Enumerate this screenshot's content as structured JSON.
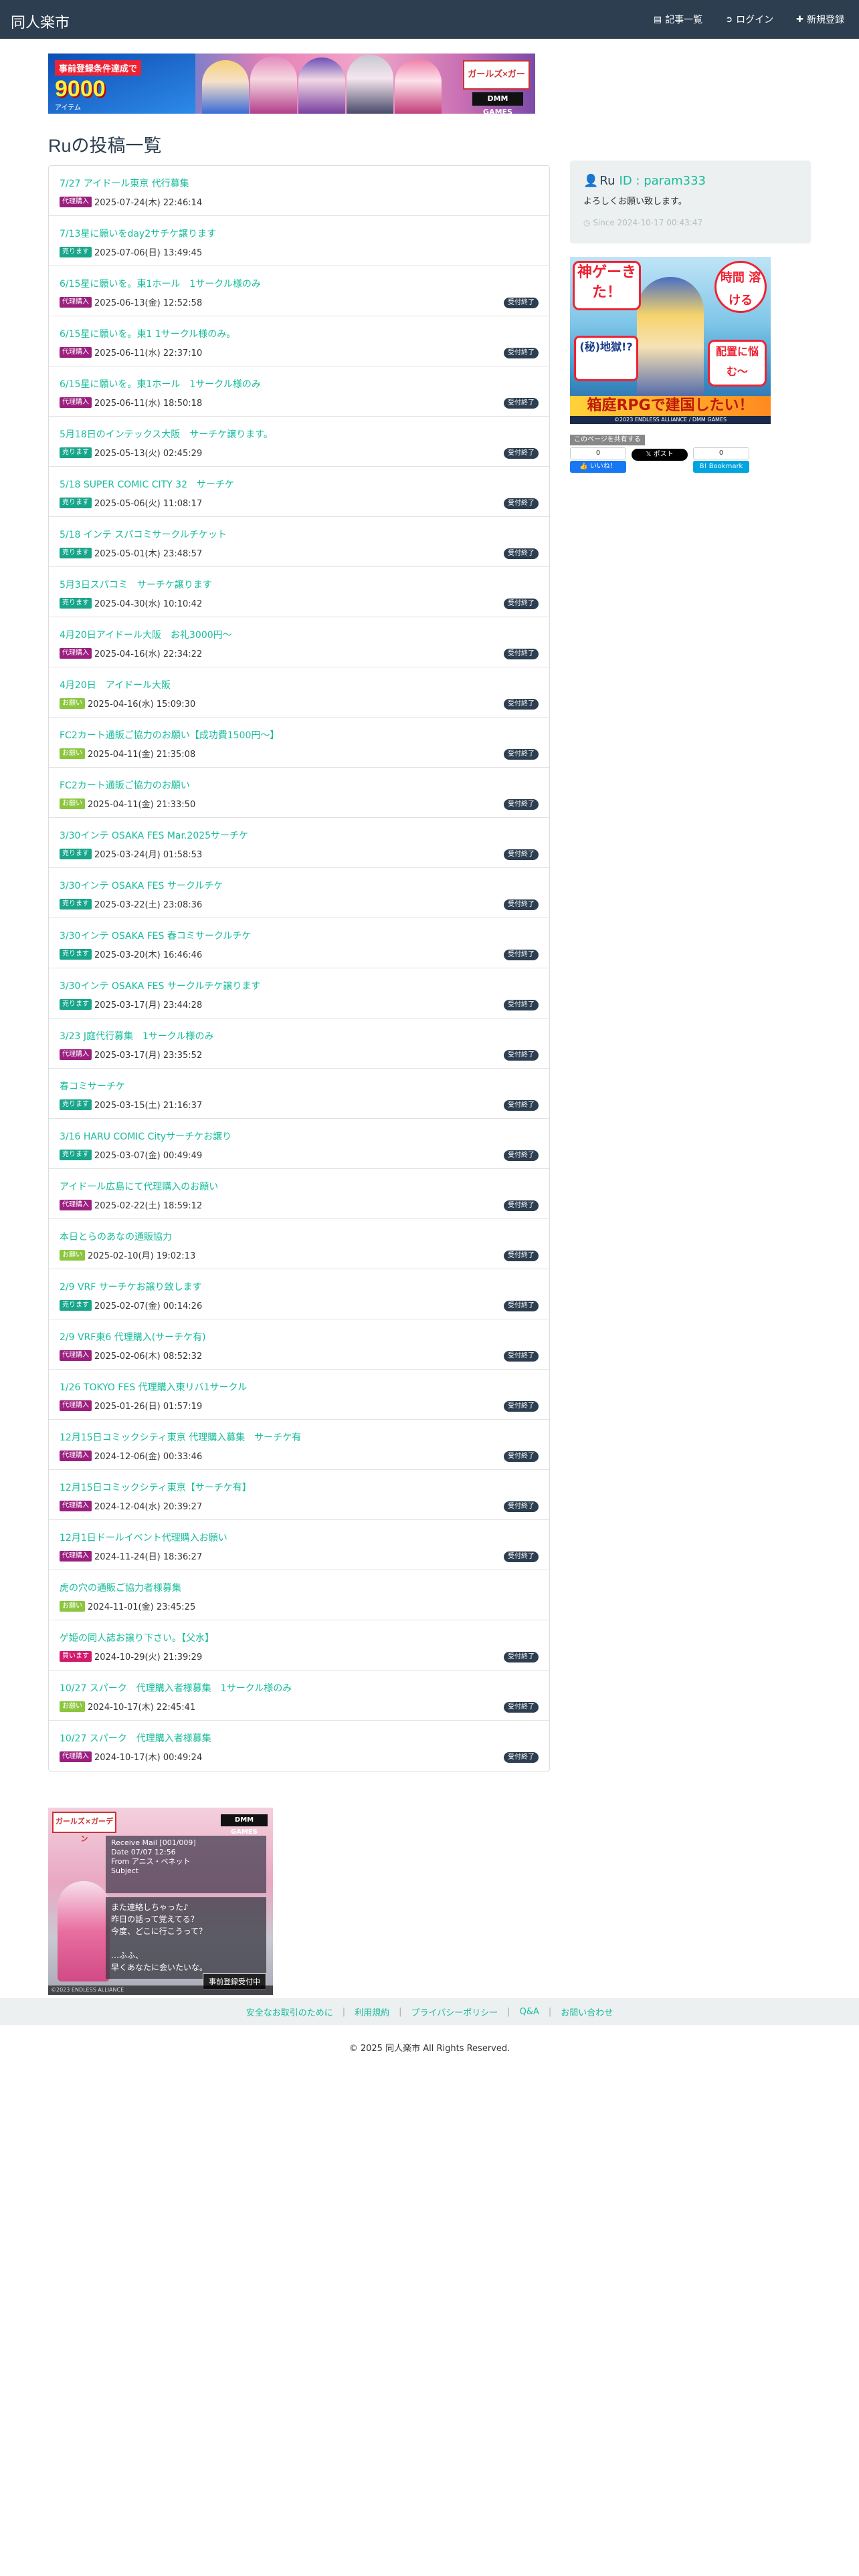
{
  "navbar": {
    "brand": "同人楽市",
    "items": [
      {
        "label": "記事一覧",
        "icon": "list-icon"
      },
      {
        "label": "ログイン",
        "icon": "login-icon"
      },
      {
        "label": "新規登録",
        "icon": "plus-icon"
      }
    ]
  },
  "top_banner": {
    "promo_line1": "事前登録条件達成で",
    "promo_big": "9000",
    "promo_unit": "アイテム",
    "logo": "ガールズ×ガーデン",
    "dmm": "DMM GAMES"
  },
  "page_title": "Ruの投稿一覧",
  "posts": [
    {
      "title": "7/27 アイドール東京 代行募集",
      "tag": "代理購入",
      "tag_type": "daiko",
      "date": "2025-07-24(木) 22:46:14",
      "closed": ""
    },
    {
      "title": "7/13星に願いをday2サチケ譲ります",
      "tag": "売ります",
      "tag_type": "uri",
      "date": "2025-07-06(日) 13:49:45",
      "closed": ""
    },
    {
      "title": "6/15星に願いを。東1ホール　1サークル様のみ",
      "tag": "代理購入",
      "tag_type": "daiko",
      "date": "2025-06-13(金) 12:52:58",
      "closed": "受付終了"
    },
    {
      "title": "6/15星に願いを。東1 1サークル様のみ。",
      "tag": "代理購入",
      "tag_type": "daiko",
      "date": "2025-06-11(水) 22:37:10",
      "closed": "受付終了"
    },
    {
      "title": "6/15星に願いを。東1ホール　1サークル様のみ",
      "tag": "代理購入",
      "tag_type": "daiko",
      "date": "2025-06-11(水) 18:50:18",
      "closed": "受付終了"
    },
    {
      "title": "5月18日のインテックス大阪　サーチケ譲ります。",
      "tag": "売ります",
      "tag_type": "uri",
      "date": "2025-05-13(火) 02:45:29",
      "closed": "受付終了"
    },
    {
      "title": "5/18 SUPER COMIC CITY 32　サーチケ",
      "tag": "売ります",
      "tag_type": "uri",
      "date": "2025-05-06(火) 11:08:17",
      "closed": "受付終了"
    },
    {
      "title": "5/18 インテ スパコミサークルチケット",
      "tag": "売ります",
      "tag_type": "uri",
      "date": "2025-05-01(木) 23:48:57",
      "closed": "受付終了"
    },
    {
      "title": "5月3日スパコミ　サーチケ譲ります",
      "tag": "売ります",
      "tag_type": "uri",
      "date": "2025-04-30(水) 10:10:42",
      "closed": "受付終了"
    },
    {
      "title": "4月20日アイドール大阪　お礼3000円〜",
      "tag": "代理購入",
      "tag_type": "daiko",
      "date": "2025-04-16(水) 22:34:22",
      "closed": "受付終了"
    },
    {
      "title": "4月20日　アイドール大阪",
      "tag": "お願い",
      "tag_type": "onegai",
      "date": "2025-04-16(水) 15:09:30",
      "closed": "受付終了"
    },
    {
      "title": "FC2カート通販ご協力のお願い【成功費1500円〜】",
      "tag": "お願い",
      "tag_type": "onegai",
      "date": "2025-04-11(金) 21:35:08",
      "closed": "受付終了"
    },
    {
      "title": "FC2カート通販ご協力のお願い",
      "tag": "お願い",
      "tag_type": "onegai",
      "date": "2025-04-11(金) 21:33:50",
      "closed": "受付終了"
    },
    {
      "title": "3/30インテ OSAKA FES Mar.2025サーチケ",
      "tag": "売ります",
      "tag_type": "uri",
      "date": "2025-03-24(月) 01:58:53",
      "closed": "受付終了"
    },
    {
      "title": "3/30インテ OSAKA FES サークルチケ",
      "tag": "売ります",
      "tag_type": "uri",
      "date": "2025-03-22(土) 23:08:36",
      "closed": "受付終了"
    },
    {
      "title": "3/30インテ OSAKA FES 春コミサークルチケ",
      "tag": "売ります",
      "tag_type": "uri",
      "date": "2025-03-20(木) 16:46:46",
      "closed": "受付終了"
    },
    {
      "title": "3/30インテ OSAKA FES サークルチケ譲ります",
      "tag": "売ります",
      "tag_type": "uri",
      "date": "2025-03-17(月) 23:44:28",
      "closed": "受付終了"
    },
    {
      "title": "3/23 J庭代行募集　1サークル様のみ",
      "tag": "代理購入",
      "tag_type": "daiko",
      "date": "2025-03-17(月) 23:35:52",
      "closed": "受付終了"
    },
    {
      "title": "春コミサーチケ",
      "tag": "売ります",
      "tag_type": "uri",
      "date": "2025-03-15(土) 21:16:37",
      "closed": "受付終了"
    },
    {
      "title": "3/16 HARU COMIC Cityサーチケお譲り",
      "tag": "売ります",
      "tag_type": "uri",
      "date": "2025-03-07(金) 00:49:49",
      "closed": "受付終了"
    },
    {
      "title": "アイドール広島にて代理購入のお願い",
      "tag": "代理購入",
      "tag_type": "daiko",
      "date": "2025-02-22(土) 18:59:12",
      "closed": "受付終了"
    },
    {
      "title": "本日とらのあなの通販協力",
      "tag": "お願い",
      "tag_type": "onegai",
      "date": "2025-02-10(月) 19:02:13",
      "closed": "受付終了"
    },
    {
      "title": "2/9 VRF サーチケお譲り致します",
      "tag": "売ります",
      "tag_type": "uri",
      "date": "2025-02-07(金) 00:14:26",
      "closed": "受付終了"
    },
    {
      "title": "2/9 VRF東6 代理購入(サーチケ有)",
      "tag": "代理購入",
      "tag_type": "daiko",
      "date": "2025-02-06(木) 08:52:32",
      "closed": "受付終了"
    },
    {
      "title": "1/26 TOKYO FES 代理購入東リバ1サークル",
      "tag": "代理購入",
      "tag_type": "daiko",
      "date": "2025-01-26(日) 01:57:19",
      "closed": "受付終了"
    },
    {
      "title": "12月15日コミックシティ東京 代理購入募集　サーチケ有",
      "tag": "代理購入",
      "tag_type": "daiko",
      "date": "2024-12-06(金) 00:33:46",
      "closed": "受付終了"
    },
    {
      "title": "12月15日コミックシティ東京【サーチケ有】",
      "tag": "代理購入",
      "tag_type": "daiko",
      "date": "2024-12-04(水) 20:39:27",
      "closed": "受付終了"
    },
    {
      "title": "12月1日ドールイベント代理購入お願い",
      "tag": "代理購入",
      "tag_type": "daiko",
      "date": "2024-11-24(日) 18:36:27",
      "closed": "受付終了"
    },
    {
      "title": "虎の穴の通販ご協力者様募集",
      "tag": "お願い",
      "tag_type": "onegai",
      "date": "2024-11-01(金) 23:45:25",
      "closed": ""
    },
    {
      "title": "ゲ姫の同人誌お譲り下さい。【父水】",
      "tag": "買います",
      "tag_type": "kai",
      "date": "2024-10-29(火) 21:39:29",
      "closed": "受付終了"
    },
    {
      "title": "10/27 スパーク　代理購入者様募集　1サークル様のみ",
      "tag": "お願い",
      "tag_type": "onegai",
      "date": "2024-10-17(木) 22:45:41",
      "closed": "受付終了"
    },
    {
      "title": "10/27 スパーク　代理購入者様募集",
      "tag": "代理購入",
      "tag_type": "daiko",
      "date": "2024-10-17(木) 00:49:24",
      "closed": "受付終了"
    }
  ],
  "profile": {
    "name": "Ru",
    "id_label": "ID : param333",
    "greeting": "よろしくお願い致します。",
    "since": "Since 2024-10-17 00:43:47"
  },
  "side_banner": {
    "tag_left": "神ゲーきた！",
    "tag_right": "時間 溶ける",
    "tag_q": "(秘)地獄!?",
    "tag_r2": "配置に悩む〜",
    "main": "箱庭RPGで建国したい！",
    "foot": "©2023 ENDLESS ALLIANCE / DMM GAMES"
  },
  "share": {
    "label": "このページを共有する",
    "fb_count": "0",
    "fb_label": "いいね！",
    "x_label": "ポスト",
    "hb_count": "0",
    "hb_label": "Bookmark"
  },
  "bottom_banner": {
    "logo": "ガールズ×ガーデン",
    "dmm": "DMM GAMES",
    "mail_lines": [
      "Receive Mail [001/009]",
      "Date  07/07 12:56",
      "From アニス・ベネット",
      "Subject"
    ],
    "msg_lines": [
      "また連絡しちゃった♪",
      "昨日の話って覚えてる？",
      "今度、どこに行こうって？",
      "",
      "…ふふ、",
      "早くあなたに会いたいな。"
    ],
    "button": "事前登録受付中",
    "copy": "©2023 ENDLESS ALLIANCE"
  },
  "footer": {
    "links": [
      "安全なお取引のために",
      "利用規約",
      "プライバシーポリシー",
      "Q&A",
      "お問い合わせ"
    ],
    "copyright": "© 2025 同人楽市 All Rights Reserved."
  }
}
